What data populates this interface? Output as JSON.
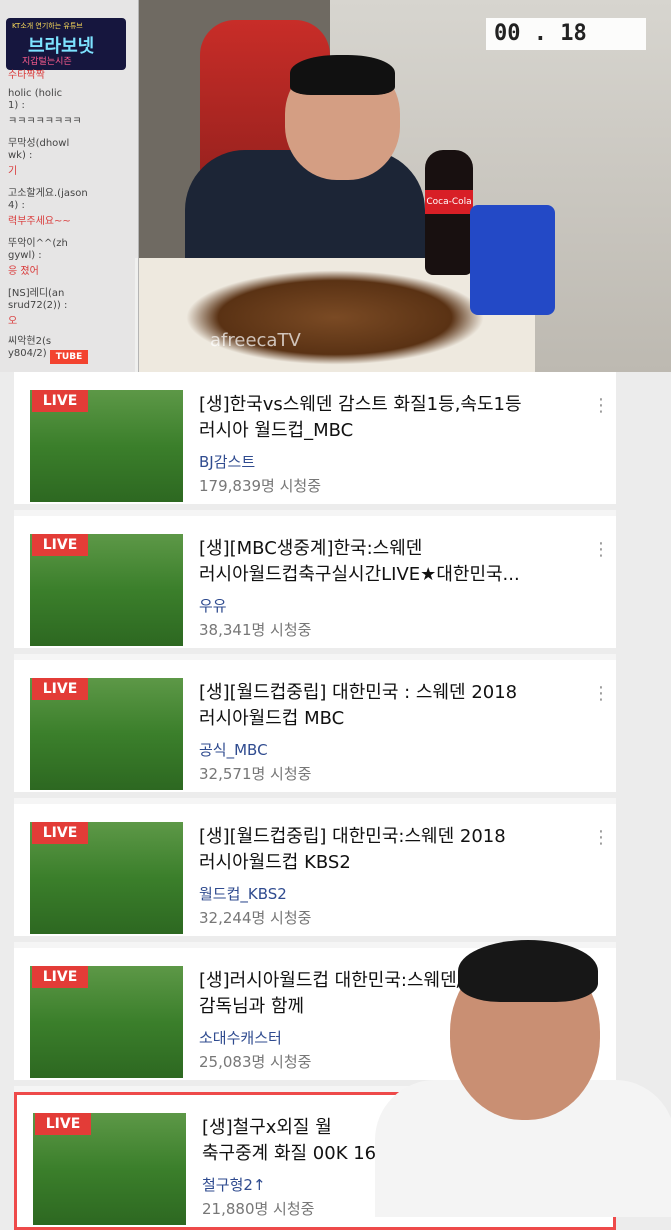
{
  "stream": {
    "timer": "00 . 18",
    "watermark": "afreecaTV",
    "logo_lines": [
      "KT소개 연기하는 유튜브",
      "브라보넷",
      "지갑털는시즌"
    ],
    "chat_lines": [
      {
        "text": "수타짝짝",
        "color": "red"
      },
      {
        "text": "holic (holic",
        "color": "normal"
      },
      {
        "text": "1) :",
        "color": "normal"
      },
      {
        "text": "ㅋㅋㅋㅋㅋㅋㅋㅋ",
        "color": "normal"
      },
      {
        "text": "무막성(dhowl",
        "color": "normal"
      },
      {
        "text": "wk) :",
        "color": "normal"
      },
      {
        "text": "기",
        "color": "red"
      },
      {
        "text": "고소할게요.(jason",
        "color": "normal"
      },
      {
        "text": "4) :",
        "color": "normal"
      },
      {
        "text": "력부주세요~~",
        "color": "red"
      },
      {
        "text": "뚜악이^^(zh",
        "color": "normal"
      },
      {
        "text": "gywl) :",
        "color": "normal"
      },
      {
        "text": "응 졌어",
        "color": "red"
      },
      {
        "text": "[NS]레디(an",
        "color": "normal"
      },
      {
        "text": "srud72(2)) :",
        "color": "normal"
      },
      {
        "text": "오",
        "color": "red"
      },
      {
        "text": "씨악현2(s",
        "color": "normal"
      },
      {
        "text": "y804/2) :",
        "color": "normal"
      }
    ],
    "tube_label": "TUBE"
  },
  "results": [
    {
      "live": "LIVE",
      "title": "[생]한국vs스웨덴 감스트 화질1등,속도1등\n러시아 월드컵_MBC",
      "channel": "BJ감스트",
      "views": "179,839명 시청중"
    },
    {
      "live": "LIVE",
      "title": "[생][MBC생중계]한국:스웨덴\n러시아월드컵축구실시간LIVE★대한민국...",
      "channel": "우유",
      "views": "38,341명 시청중"
    },
    {
      "live": "LIVE",
      "title": "[생][월드컵중립] 대한민국 : 스웨덴 2018\n러시아월드컵 MBC",
      "channel": "공식_MBC",
      "views": "32,571명 시청중"
    },
    {
      "live": "LIVE",
      "title": "[생][월드컵중립] 대한민국:스웨덴 2018\n러시아월드컵 KBS2",
      "channel": "월드컵_KBS2",
      "views": "32,244명 시청중"
    },
    {
      "live": "LIVE",
      "title": "[생]러시아월드컵 대한민국:스웨덴/\n감독님과 함께",
      "channel": "소대수캐스터",
      "views": "25,083명 시청중"
    },
    {
      "live": "LIVE",
      "title": "[생]철구x외질 월\n축구중계 화질 00K 16강",
      "channel": "철구형2↑",
      "views": "21,880명 시청중"
    }
  ],
  "icons": {
    "menu": "more-vert-icon"
  }
}
